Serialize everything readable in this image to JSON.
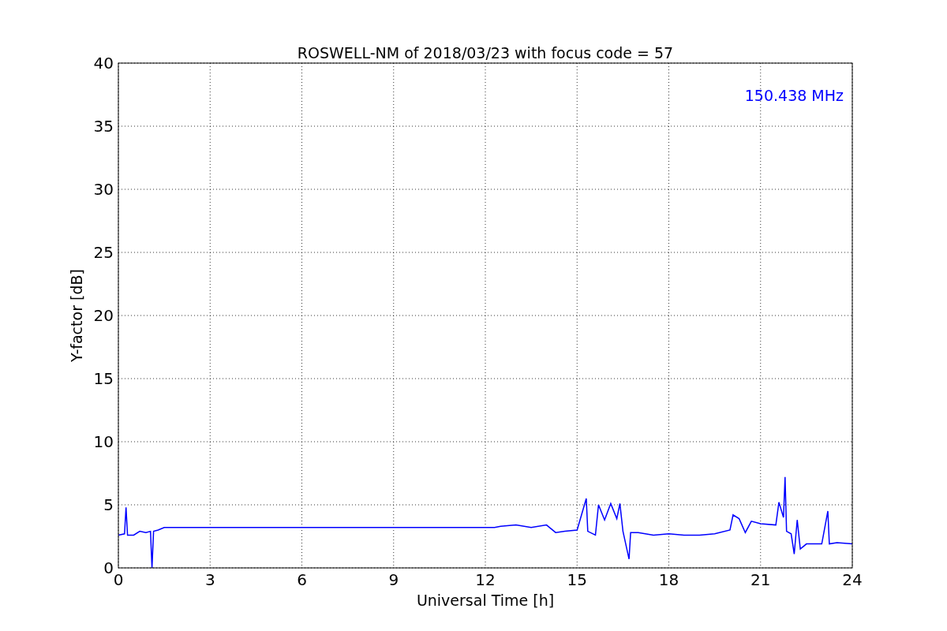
{
  "chart": {
    "chart_data": {
      "type": "line",
      "title": "ROSWELL-NM of 2018/03/23 with focus code = 57",
      "xlabel": "Universal Time [h]",
      "ylabel": "Y-factor [dB]",
      "xlim": [
        0,
        24
      ],
      "ylim": [
        0,
        40
      ],
      "xticks": [
        0,
        3,
        6,
        9,
        12,
        15,
        18,
        21,
        24
      ],
      "yticks": [
        0,
        5,
        10,
        15,
        20,
        25,
        30,
        35,
        40
      ],
      "series": [
        {
          "name": "150.438 MHz",
          "color": "#0000ff",
          "x": [
            0,
            0.2,
            0.25,
            0.3,
            0.5,
            0.7,
            0.9,
            1.05,
            1.1,
            1.15,
            1.3,
            1.5,
            12.3,
            12.5,
            13,
            13.5,
            14,
            14.3,
            14.6,
            15,
            15.3,
            15.35,
            15.6,
            15.7,
            15.9,
            16.1,
            16.3,
            16.4,
            16.5,
            16.7,
            16.75,
            17,
            17.5,
            18,
            18.5,
            19,
            19.5,
            20,
            20.1,
            20.3,
            20.5,
            20.7,
            21,
            21.5,
            21.6,
            21.75,
            21.8,
            21.85,
            22,
            22.1,
            22.2,
            22.3,
            22.5,
            23,
            23.2,
            23.25,
            23.5,
            24
          ],
          "values": [
            2.6,
            2.7,
            4.8,
            2.6,
            2.6,
            2.9,
            2.8,
            2.9,
            0,
            2.9,
            3.0,
            3.2,
            3.2,
            3.3,
            3.4,
            3.2,
            3.4,
            2.8,
            2.9,
            3.0,
            5.5,
            2.9,
            2.6,
            5.0,
            3.8,
            5.1,
            3.9,
            5.1,
            2.9,
            0.7,
            2.8,
            2.8,
            2.6,
            2.7,
            2.6,
            2.6,
            2.7,
            3.0,
            4.2,
            3.9,
            2.8,
            3.7,
            3.5,
            3.4,
            5.2,
            4.0,
            7.2,
            2.9,
            2.7,
            1.1,
            3.8,
            1.5,
            1.9,
            1.9,
            4.5,
            1.9,
            2.0,
            1.9
          ]
        }
      ],
      "grid": true
    }
  }
}
